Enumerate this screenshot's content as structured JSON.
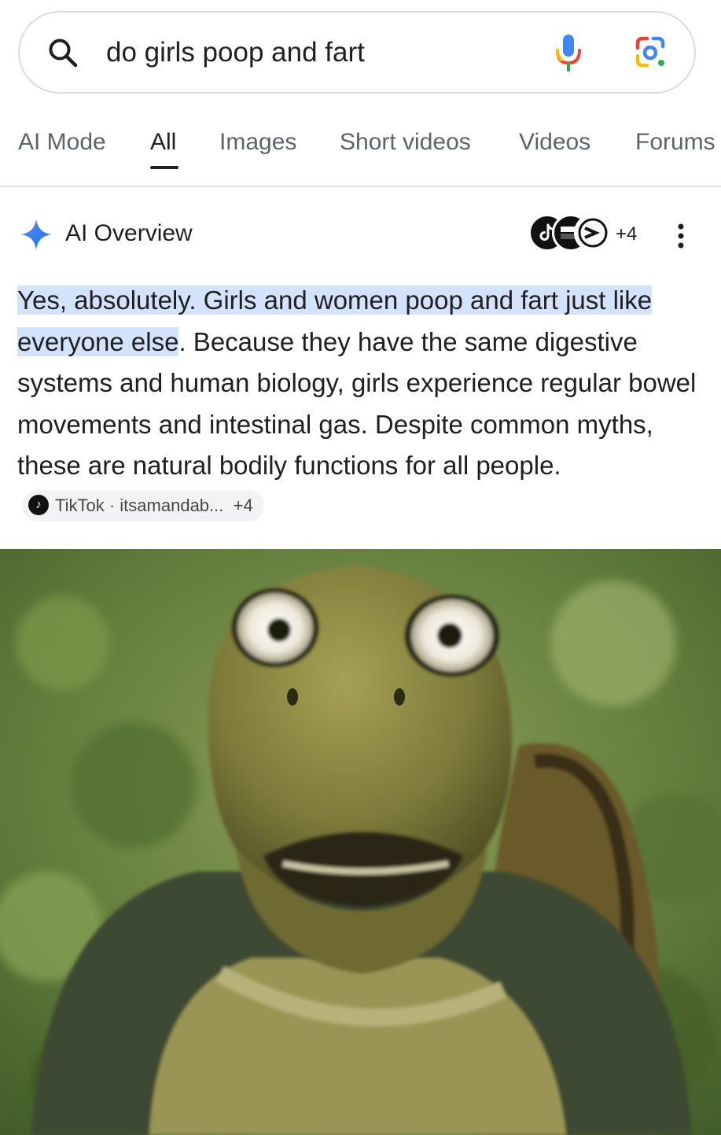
{
  "search": {
    "query": "do girls poop and fart"
  },
  "tabs": [
    {
      "label": "AI Mode"
    },
    {
      "label": "All"
    },
    {
      "label": "Images"
    },
    {
      "label": "Short videos"
    },
    {
      "label": "Videos"
    },
    {
      "label": "Forums"
    }
  ],
  "active_tab": "All",
  "ai_overview": {
    "title": "AI Overview",
    "source_count": "+4",
    "highlighted_text": "Yes, absolutely. Girls and women poop and fart just like everyone else",
    "body_text": ". Because they have the same digestive systems and human biology, girls experience regular bowel movements and intestinal gas. Despite common myths, these are natural bodily functions for all people.",
    "citation": {
      "label": "TikTok · itsamandab...",
      "extra": "+4"
    }
  },
  "colors": {
    "highlight": "#d3e3fd",
    "accent_blue": "#4285f4",
    "google_red": "#ea4335",
    "google_yellow": "#fbbc04",
    "google_green": "#34a853"
  },
  "icons": {
    "search": "search-icon",
    "mic": "mic-icon",
    "lens": "google-lens-icon",
    "sparkle": "ai-sparkle-icon",
    "more": "more-vert-icon",
    "tiktok": "tiktok-icon"
  },
  "image": {
    "subject": "turtle-meme-image"
  }
}
